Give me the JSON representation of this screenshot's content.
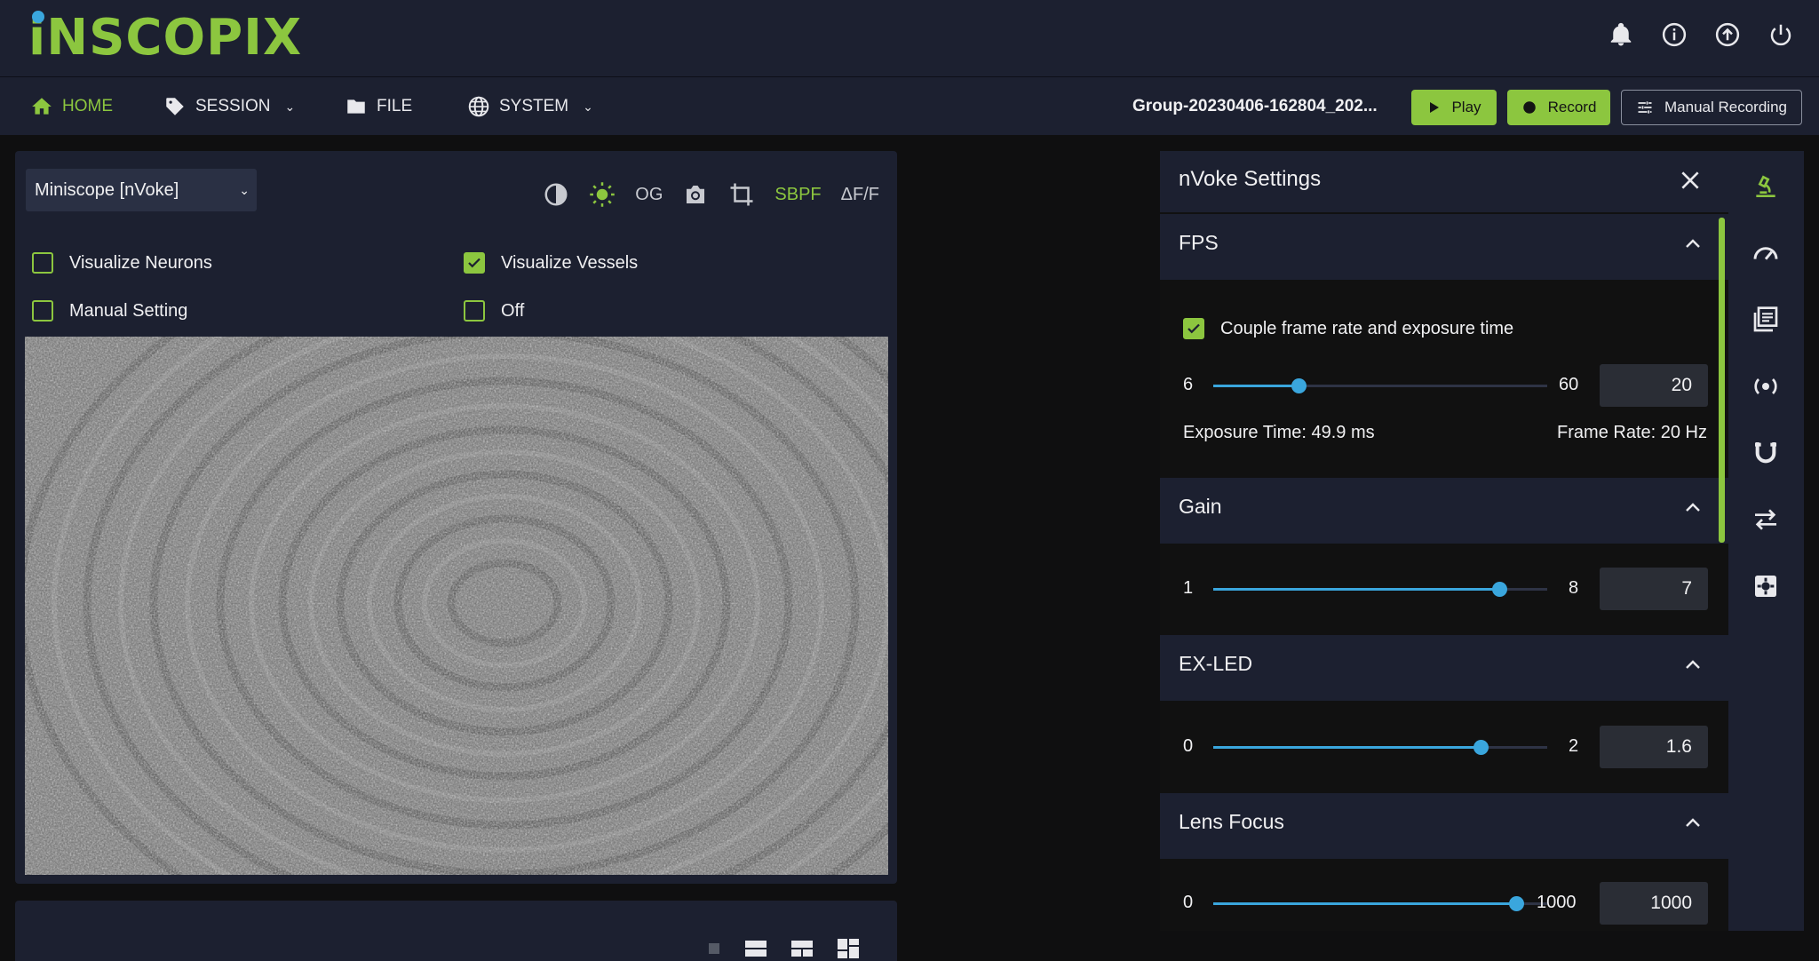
{
  "app": {
    "logo": "iNSCOPIX"
  },
  "nav": {
    "home": "HOME",
    "session": "SESSION",
    "file": "FILE",
    "system": "SYSTEM",
    "group_name": "Group-20230406-162804_202...",
    "play": "Play",
    "record": "Record",
    "manual_recording": "Manual Recording"
  },
  "viewer": {
    "device": "Miniscope [nVoke]",
    "tools": {
      "og": "OG",
      "sbpf": "SBPF",
      "dff": "ΔF/F"
    },
    "visualize_neurons": "Visualize Neurons",
    "visualize_vessels": "Visualize Vessels",
    "manual_setting": "Manual Setting",
    "off": "Off",
    "visualize_neurons_checked": false,
    "visualize_vessels_checked": true,
    "manual_setting_checked": false,
    "off_checked": false
  },
  "settings": {
    "title": "nVoke Settings",
    "fps": {
      "title": "FPS",
      "couple_label": "Couple frame rate and exposure time",
      "couple_checked": true,
      "min": "6",
      "max": "60",
      "value": "20",
      "exposure": "Exposure Time: 49.9 ms",
      "frame_rate": "Frame Rate: 20 Hz"
    },
    "gain": {
      "title": "Gain",
      "min": "1",
      "max": "8",
      "value": "7"
    },
    "exled": {
      "title": "EX-LED",
      "min": "0",
      "max": "2",
      "value": "1.6"
    },
    "lens": {
      "title": "Lens Focus",
      "min": "0",
      "max": "1000",
      "value": "1000"
    }
  },
  "colors": {
    "accent": "#8cc63f",
    "slider": "#3aa6dd",
    "panel": "#1c2030",
    "background": "#0f0f10"
  },
  "icons": [
    "bell-icon",
    "info-icon",
    "upload-icon",
    "power-icon",
    "home-icon",
    "tag-icon",
    "folder-icon",
    "globe-icon",
    "play-icon",
    "record-icon",
    "tune-icon",
    "contrast-icon",
    "brightness-icon",
    "camera-icon",
    "crop-icon",
    "microscope-icon",
    "speedometer-icon",
    "library-icon",
    "broadcast-icon",
    "magnet-icon",
    "swap-icon",
    "settings-gear-icon"
  ]
}
